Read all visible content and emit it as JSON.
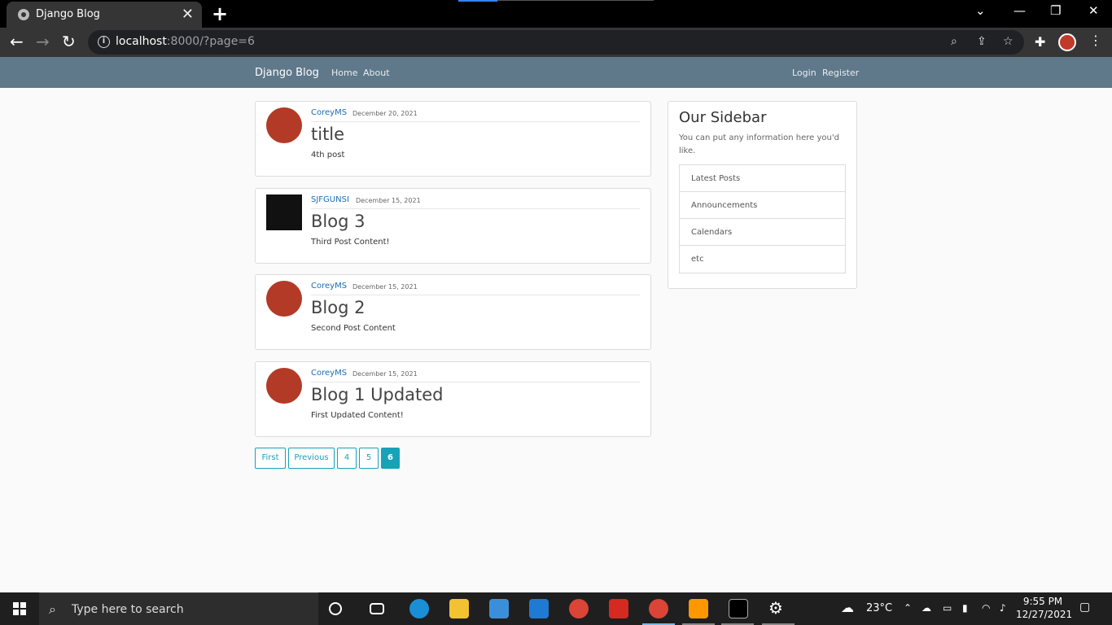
{
  "browser": {
    "tab_title": "Django Blog",
    "url_host": "localhost",
    "url_rest": ":8000/?page=6"
  },
  "site": {
    "brand": "Django Blog",
    "nav_left": [
      "Home",
      "About"
    ],
    "nav_right": [
      "Login",
      "Register"
    ]
  },
  "posts": [
    {
      "author": "CoreyMS",
      "date": "December 20, 2021",
      "title": "title",
      "content": "4th post"
    },
    {
      "author": "SJFGUNSI",
      "date": "December 15, 2021",
      "title": "Blog 3",
      "content": "Third Post Content!"
    },
    {
      "author": "CoreyMS",
      "date": "December 15, 2021",
      "title": "Blog 2",
      "content": "Second Post Content"
    },
    {
      "author": "CoreyMS",
      "date": "December 15, 2021",
      "title": "Blog 1 Updated",
      "content": "First Updated Content!"
    }
  ],
  "pagination": [
    "First",
    "Previous",
    "4",
    "5",
    "6"
  ],
  "pagination_active": "6",
  "sidebar": {
    "title": "Our Sidebar",
    "text": "You can put any information here you'd like.",
    "items": [
      "Latest Posts",
      "Announcements",
      "Calendars",
      "etc"
    ]
  },
  "taskbar": {
    "search_placeholder": "Type here to search",
    "temperature": "23°C",
    "time": "9:55 PM",
    "date": "12/27/2021"
  },
  "colors": {
    "navbar": "#5f788a",
    "accent": "#17a2b8",
    "author_link": "#1a6db5"
  }
}
